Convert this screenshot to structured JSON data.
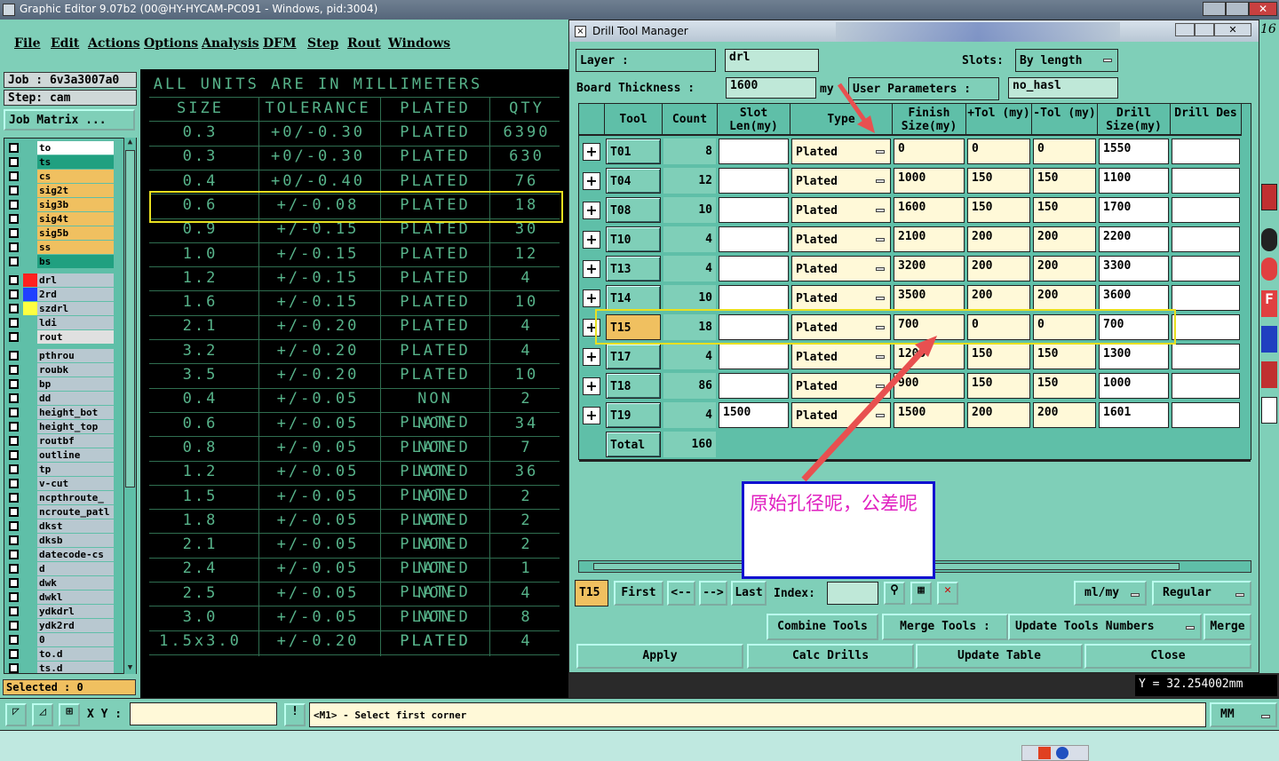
{
  "window_title": "Graphic Editor 9.07b2 (00@HY-HYCAM-PC091 - Windows, pid:3004)",
  "menu": [
    "File",
    "Edit",
    "Actions",
    "Options",
    "Analysis",
    "DFM",
    "Step",
    "Rout",
    "Windows"
  ],
  "left": {
    "job": "Job : 6v3a3007a0",
    "step": "Step: cam",
    "job_matrix": "Job Matrix ...",
    "selected": "Selected : 0"
  },
  "layers": [
    {
      "name": "to",
      "color": "#ffffff"
    },
    {
      "name": "ts",
      "color": "#20a080"
    },
    {
      "name": "cs",
      "color": "#f0c060"
    },
    {
      "name": "sig2t",
      "color": "#f0c060"
    },
    {
      "name": "sig3b",
      "color": "#f0c060"
    },
    {
      "name": "sig4t",
      "color": "#f0c060"
    },
    {
      "name": "sig5b",
      "color": "#f0c060"
    },
    {
      "name": "ss",
      "color": "#f0c060"
    },
    {
      "name": "bs",
      "color": "#20a080"
    },
    {
      "name": "drl",
      "color": "#b8c8d0",
      "swatch": "#ff2020"
    },
    {
      "name": "2rd",
      "color": "#b8c8d0",
      "swatch": "#2040ff"
    },
    {
      "name": "szdrl",
      "color": "#b8c8d0",
      "swatch": "#ffff40"
    },
    {
      "name": "ldi",
      "color": "#b8c8d0"
    },
    {
      "name": "rout",
      "color": "#e0e0e0"
    },
    {
      "name": "pthrou",
      "color": "#b8c8d0"
    },
    {
      "name": "roubk",
      "color": "#b8c8d0"
    },
    {
      "name": "bp",
      "color": "#b8c8d0"
    },
    {
      "name": "dd",
      "color": "#b8c8d0"
    },
    {
      "name": "height_bot",
      "color": "#b8c8d0"
    },
    {
      "name": "height_top",
      "color": "#b8c8d0"
    },
    {
      "name": "routbf",
      "color": "#b8c8d0"
    },
    {
      "name": "outline",
      "color": "#b8c8d0"
    },
    {
      "name": "tp",
      "color": "#b8c8d0"
    },
    {
      "name": "v-cut",
      "color": "#b8c8d0"
    },
    {
      "name": "ncpthroute_",
      "color": "#b8c8d0"
    },
    {
      "name": "ncroute_patl",
      "color": "#b8c8d0"
    },
    {
      "name": "dkst",
      "color": "#b8c8d0"
    },
    {
      "name": "dksb",
      "color": "#b8c8d0"
    },
    {
      "name": "datecode-cs",
      "color": "#b8c8d0"
    },
    {
      "name": "d",
      "color": "#b8c8d0"
    },
    {
      "name": "dwk",
      "color": "#b8c8d0"
    },
    {
      "name": "dwkl",
      "color": "#b8c8d0"
    },
    {
      "name": "ydkdrl",
      "color": "#b8c8d0"
    },
    {
      "name": "ydk2rd",
      "color": "#b8c8d0"
    },
    {
      "name": "0",
      "color": "#b8c8d0"
    },
    {
      "name": "to.d",
      "color": "#b8c8d0"
    },
    {
      "name": "ts.d",
      "color": "#b8c8d0"
    }
  ],
  "graphic": {
    "heading": "ALL UNITS ARE IN MILLIMETERS",
    "columns": [
      "SIZE",
      "TOLERANCE",
      "PLATED",
      "QTY"
    ],
    "rows": [
      [
        "0.3",
        "+0/-0.30",
        "PLATED",
        "6390"
      ],
      [
        "0.3",
        "+0/-0.30",
        "PLATED",
        "630"
      ],
      [
        "0.4",
        "+0/-0.40",
        "PLATED",
        "76"
      ],
      [
        "0.6",
        "+/-0.08",
        "PLATED",
        "18"
      ],
      [
        "0.9",
        "+/-0.15",
        "PLATED",
        "30"
      ],
      [
        "1.0",
        "+/-0.15",
        "PLATED",
        "12"
      ],
      [
        "1.2",
        "+/-0.15",
        "PLATED",
        "4"
      ],
      [
        "1.6",
        "+/-0.15",
        "PLATED",
        "10"
      ],
      [
        "2.1",
        "+/-0.20",
        "PLATED",
        "4"
      ],
      [
        "3.2",
        "+/-0.20",
        "PLATED",
        "4"
      ],
      [
        "3.5",
        "+/-0.20",
        "PLATED",
        "10"
      ],
      [
        "0.4",
        "+/-0.05",
        "NON PLATED",
        "2"
      ],
      [
        "0.6",
        "+/-0.05",
        "NON PLATED",
        "34"
      ],
      [
        "0.8",
        "+/-0.05",
        "NON PLATED",
        "7"
      ],
      [
        "1.2",
        "+/-0.05",
        "NON PLATED",
        "36"
      ],
      [
        "1.5",
        "+/-0.05",
        "NON PLATED",
        "2"
      ],
      [
        "1.8",
        "+/-0.05",
        "NON PLATED",
        "2"
      ],
      [
        "2.1",
        "+/-0.05",
        "NON PLATED",
        "2"
      ],
      [
        "2.4",
        "+/-0.05",
        "NON PLATED",
        "1"
      ],
      [
        "2.5",
        "+/-0.05",
        "NON PLATED",
        "4"
      ],
      [
        "3.0",
        "+/-0.05",
        "NON PLATED",
        "8"
      ],
      [
        "1.5x3.0",
        "+/-0.20",
        "PLATED",
        "4"
      ]
    ]
  },
  "dtm": {
    "title": "Drill Tool Manager",
    "layer_label": "Layer :",
    "layer_value": "drl",
    "slots_label": "Slots:",
    "slots_value": "By length",
    "thickness_label": "Board Thickness :",
    "thickness_value": "1600",
    "thickness_unit": "my",
    "user_params_label": "User Parameters :",
    "user_params_value": "no_hasl",
    "headers": [
      "Tool",
      "Count",
      "Slot Len(my)",
      "Type",
      "Finish Size(my)",
      "+Tol (my)",
      "-Tol (my)",
      "Drill Size(my)",
      "Drill Des"
    ],
    "rows": [
      {
        "tool": "T01",
        "count": "8",
        "slot": "",
        "type": "Plated",
        "finish": "0",
        "ptol": "0",
        "mtol": "0",
        "drill": "1550",
        "des": ""
      },
      {
        "tool": "T04",
        "count": "12",
        "slot": "",
        "type": "Plated",
        "finish": "1000",
        "ptol": "150",
        "mtol": "150",
        "drill": "1100",
        "des": ""
      },
      {
        "tool": "T08",
        "count": "10",
        "slot": "",
        "type": "Plated",
        "finish": "1600",
        "ptol": "150",
        "mtol": "150",
        "drill": "1700",
        "des": ""
      },
      {
        "tool": "T10",
        "count": "4",
        "slot": "",
        "type": "Plated",
        "finish": "2100",
        "ptol": "200",
        "mtol": "200",
        "drill": "2200",
        "des": ""
      },
      {
        "tool": "T13",
        "count": "4",
        "slot": "",
        "type": "Plated",
        "finish": "3200",
        "ptol": "200",
        "mtol": "200",
        "drill": "3300",
        "des": ""
      },
      {
        "tool": "T14",
        "count": "10",
        "slot": "",
        "type": "Plated",
        "finish": "3500",
        "ptol": "200",
        "mtol": "200",
        "drill": "3600",
        "des": ""
      },
      {
        "tool": "T15",
        "count": "18",
        "slot": "",
        "type": "Plated",
        "finish": "700",
        "ptol": "0",
        "mtol": "0",
        "drill": "700",
        "des": ""
      },
      {
        "tool": "T17",
        "count": "4",
        "slot": "",
        "type": "Plated",
        "finish": "1200",
        "ptol": "150",
        "mtol": "150",
        "drill": "1300",
        "des": ""
      },
      {
        "tool": "T18",
        "count": "86",
        "slot": "",
        "type": "Plated",
        "finish": "900",
        "ptol": "150",
        "mtol": "150",
        "drill": "1000",
        "des": ""
      },
      {
        "tool": "T19",
        "count": "4",
        "slot": "1500",
        "type": "Plated",
        "finish": "1500",
        "ptol": "200",
        "mtol": "200",
        "drill": "1601",
        "des": ""
      }
    ],
    "total_label": "Total",
    "total_value": "160",
    "nav": {
      "current": "T15",
      "first": "First",
      "prev": "<--",
      "next": "-->",
      "last": "Last",
      "index": "Index:",
      "units": "ml/my",
      "mode": "Regular"
    },
    "buttons": {
      "combine": "Combine Tools",
      "merge_tools": "Merge Tools :",
      "update_numbers": "Update Tools Numbers",
      "merge": "Merge",
      "apply": "Apply",
      "calc": "Calc Drills",
      "update_table": "Update Table",
      "close": "Close"
    }
  },
  "annotation": "原始孔径呢，公差呢",
  "status": {
    "xy_label": "X Y :",
    "prompt": "<M1> - Select first corner",
    "unit": "MM",
    "y_coord": "Y = 32.254002mm",
    "corner_num": "16"
  }
}
